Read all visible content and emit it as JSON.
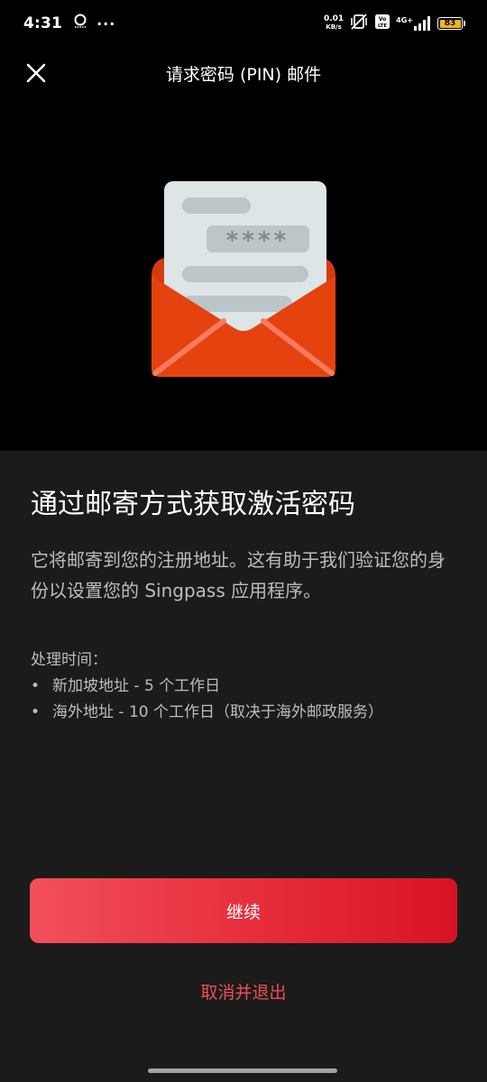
{
  "status_bar": {
    "time": "4:31",
    "extra_icons": "···",
    "net_speed_value": "0.01",
    "net_speed_unit": "KB/s",
    "network_label": "4G+",
    "battery_level": "83",
    "battery_color": "#f0b21e"
  },
  "header": {
    "title": "请求密码 (PIN) 邮件"
  },
  "illustration": {
    "pin_mask": "****",
    "envelope_color": "#e4420f",
    "letter_color": "#dde5e6"
  },
  "content": {
    "title": "通过邮寄方式获取激活密码",
    "description": "它将邮寄到您的注册地址。这有助于我们验证您的身份以设置您的 Singpass 应用程序。",
    "processing_label": "处理时间：",
    "bullet_char": "•",
    "processing_items": [
      "新加坡地址 - 5 个工作日",
      "海外地址 - 10 个工作日（取决于海外邮政服务）"
    ]
  },
  "actions": {
    "continue_label": "继续",
    "cancel_label": "取消并退出",
    "primary_color": "#e62c3a",
    "cancel_color": "#ef4e55"
  }
}
